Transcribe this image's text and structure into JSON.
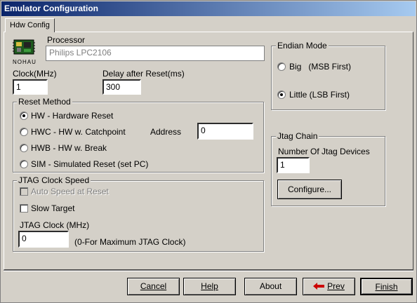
{
  "window": {
    "title": "Emulator Configuration"
  },
  "tabs": [
    {
      "label": "Hdw Config"
    }
  ],
  "processor": {
    "label": "Processor",
    "value": "Philips LPC2106",
    "chip_caption": "NOHAU"
  },
  "clock": {
    "label": "Clock(MHz)",
    "value": "1"
  },
  "delay": {
    "label": "Delay after Reset(ms)",
    "value": "300"
  },
  "reset_method": {
    "title": "Reset Method",
    "options": [
      {
        "label": "HW - Hardware Reset",
        "selected": true
      },
      {
        "label": "HWC - HW w. Catchpoint",
        "selected": false
      },
      {
        "label": "HWB - HW w. Break",
        "selected": false
      },
      {
        "label": "SIM - Simulated Reset (set PC)",
        "selected": false
      }
    ],
    "address_label": "Address",
    "address_value": "0"
  },
  "jtag_clock_speed": {
    "title": "JTAG Clock Speed",
    "auto_speed_label": "Auto Speed at Reset",
    "slow_target_label": "Slow Target",
    "clock_label": "JTAG Clock (MHz)",
    "clock_value": "0",
    "clock_hint": "(0-For Maximum JTAG Clock)"
  },
  "endian_mode": {
    "title": "Endian Mode",
    "options": [
      {
        "label": "Big   (MSB First)",
        "selected": false
      },
      {
        "label": "Little (LSB First)",
        "selected": true
      }
    ]
  },
  "jtag_chain": {
    "title": "Jtag Chain",
    "devices_label": "Number Of Jtag Devices",
    "devices_value": "1",
    "configure_label": "Configure..."
  },
  "buttons": {
    "cancel": "Cancel",
    "help": "Help",
    "about": "About",
    "prev": "Prev",
    "finish": "Finish"
  },
  "colors": {
    "titlebar_start": "#0a246a",
    "titlebar_end": "#a6caf0",
    "face": "#d4d0c8",
    "prev_arrow": "#cc0000"
  }
}
